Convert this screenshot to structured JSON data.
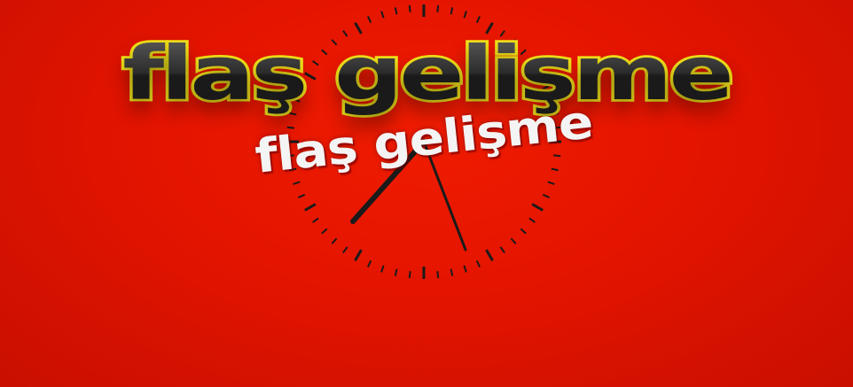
{
  "banner": {
    "headline": "flaş gelişme",
    "subline": "flaş gelişme"
  },
  "colors": {
    "background": "#e31400",
    "headline_fill": "#1a1a1a",
    "headline_outline": "#f2e21a",
    "subline_fill": "#f4f4f4",
    "clock_marks": "#1a1a1a"
  },
  "icons": [
    "clock-icon"
  ]
}
